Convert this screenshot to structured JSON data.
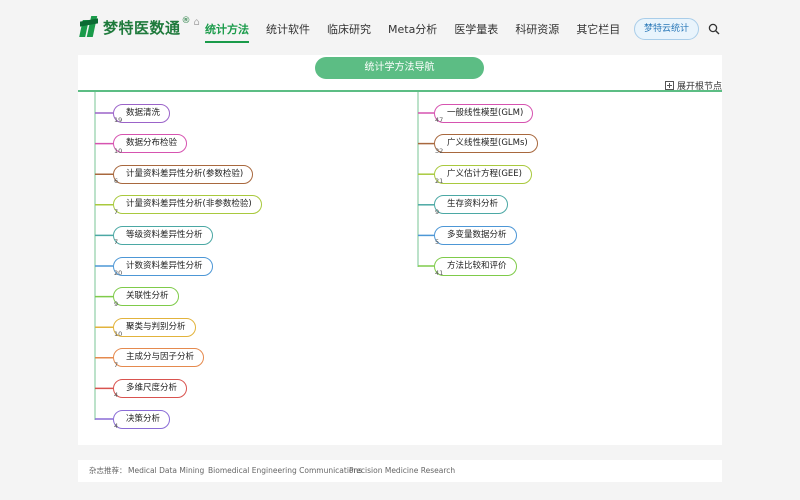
{
  "brand": {
    "name": "梦特医数通",
    "mark": "®"
  },
  "nav": [
    "统计方法",
    "统计软件",
    "临床研究",
    "Meta分析",
    "医学量表",
    "科研资源",
    "其它栏目"
  ],
  "nav_active": 0,
  "cloud_button": "梦特云统计",
  "panel": {
    "title": "统计学方法导航",
    "expand_label": "展开根节点"
  },
  "left_nodes": [
    {
      "label": "数据清洗",
      "count": "19",
      "color": "#9b63c9"
    },
    {
      "label": "数据分布检验",
      "count": "10",
      "color": "#d653b0"
    },
    {
      "label": "计量资料差异性分析(参数检验)",
      "count": "6",
      "color": "#a8683e"
    },
    {
      "label": "计量资料差异性分析(非参数检验)",
      "count": "7",
      "color": "#a9c93e"
    },
    {
      "label": "等级资料差异性分析",
      "count": "7",
      "color": "#4ba8a4"
    },
    {
      "label": "计数资料差异性分析",
      "count": "20",
      "color": "#4d97d6"
    },
    {
      "label": "关联性分析",
      "count": "9",
      "color": "#7fcb4a"
    },
    {
      "label": "聚类与判别分析",
      "count": "10",
      "color": "#e2b33c"
    },
    {
      "label": "主成分与因子分析",
      "count": "7",
      "color": "#e58a4e"
    },
    {
      "label": "多维尺度分析",
      "count": "4",
      "color": "#d9534f"
    },
    {
      "label": "决策分析",
      "count": "4",
      "color": "#8a6cd6"
    }
  ],
  "right_nodes": [
    {
      "label": "一般线性模型(GLM)",
      "count": "47",
      "color": "#d653b0"
    },
    {
      "label": "广义线性模型(GLMs)",
      "count": "32",
      "color": "#a8683e"
    },
    {
      "label": "广义估计方程(GEE)",
      "count": "21",
      "color": "#a9c93e"
    },
    {
      "label": "生存资料分析",
      "count": "9",
      "color": "#4ba8a4"
    },
    {
      "label": "多变量数据分析",
      "count": "5",
      "color": "#4d97d6"
    },
    {
      "label": "方法比较和评价",
      "count": "41",
      "color": "#7fcb4a"
    }
  ],
  "footer": {
    "label": "杂志推荐：",
    "items": [
      "Medical Data Mining",
      "Biomedical Engineering Communications",
      "Precision Medicine Research"
    ]
  }
}
